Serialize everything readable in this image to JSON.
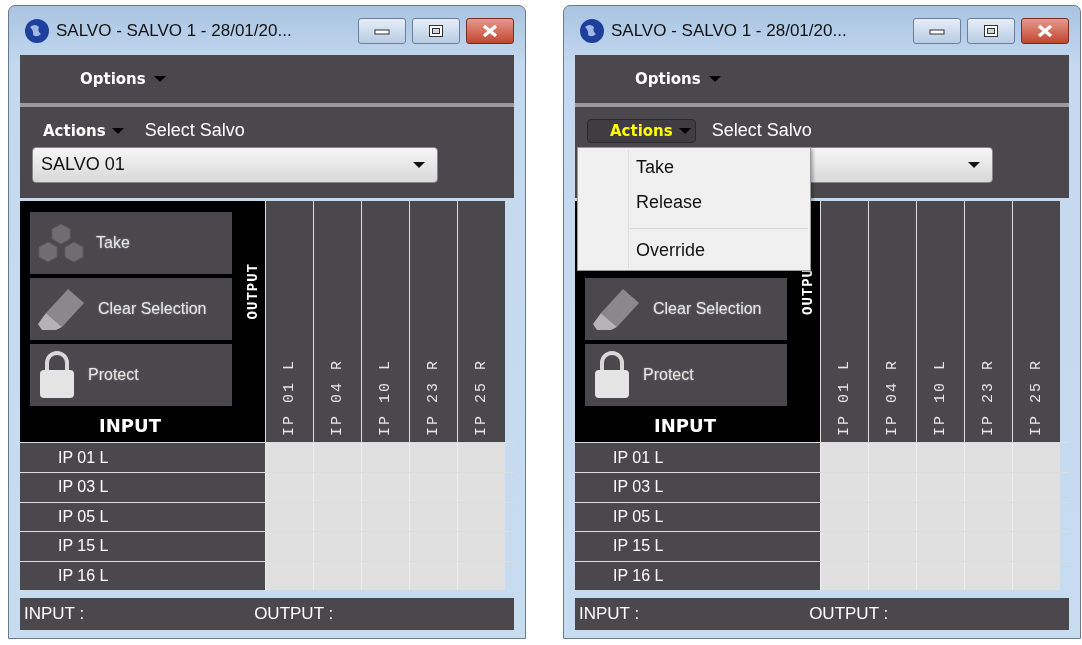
{
  "windows": [
    {
      "title": "SALVO - SALVO 1 - 28/01/20...",
      "options": {
        "label": "Options"
      },
      "actions": {
        "label": "Actions",
        "open": false
      },
      "select_label": "Select Salvo",
      "salvo_dropdown": {
        "value": "SALVO 01"
      },
      "buttons": [
        {
          "kind": "take",
          "label": "Take"
        },
        {
          "kind": "clear",
          "label": "Clear Selection"
        },
        {
          "kind": "protect",
          "label": "Protect"
        }
      ],
      "output_heading": "OUTPUT",
      "input_heading": "INPUT",
      "columns": [
        "IP 01 L",
        "IP 04 R",
        "IP 10 L",
        "IP 23 R",
        "IP 25 R"
      ],
      "rows": [
        "IP 01 L",
        "IP 03 L",
        "IP 05 L",
        "IP 15 L",
        "IP 16 L"
      ],
      "status_bar": {
        "input": "INPUT :",
        "output": "OUTPUT :"
      }
    },
    {
      "title": "SALVO - SALVO 1 - 28/01/20...",
      "options": {
        "label": "Options"
      },
      "actions": {
        "label": "Actions",
        "open": true,
        "menu": [
          {
            "kind": "item",
            "label": "Take"
          },
          {
            "kind": "item",
            "label": "Release"
          },
          {
            "kind": "separator"
          },
          {
            "kind": "item",
            "label": "Override"
          }
        ]
      },
      "select_label": "Select Salvo",
      "buttons": [
        {
          "kind": "clear",
          "label": "Clear Selection"
        },
        {
          "kind": "protect",
          "label": "Protect"
        }
      ],
      "output_heading": "OUTPU",
      "input_heading": "INPUT",
      "columns": [
        "IP 01 L",
        "IP 04 R",
        "IP 10 L",
        "IP 23 R",
        "IP 25 R"
      ],
      "rows": [
        "IP 01 L",
        "IP 03 L",
        "IP 05 L",
        "IP 15 L",
        "IP 16 L"
      ],
      "status_bar": {
        "input": "INPUT :",
        "output": "OUTPUT :"
      }
    }
  ]
}
